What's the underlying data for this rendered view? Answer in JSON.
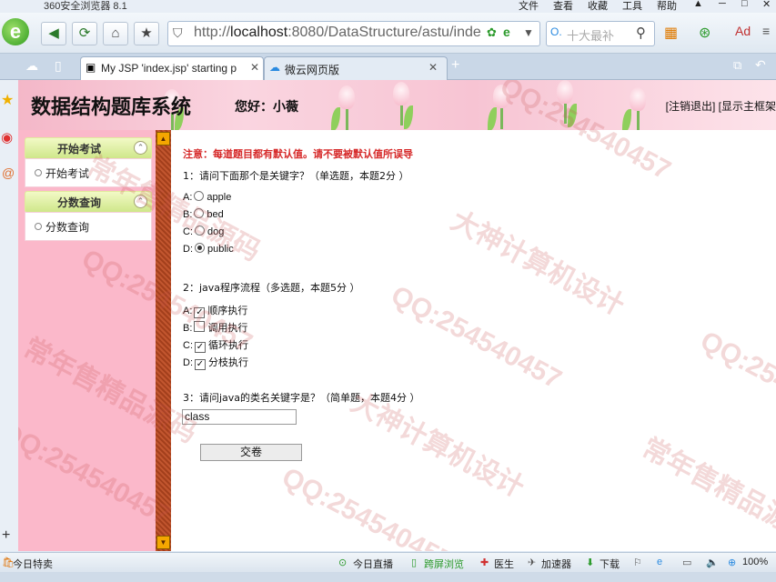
{
  "browser": {
    "title": "360安全浏览器 8.1",
    "menu": [
      "文件",
      "查看",
      "收藏",
      "工具",
      "帮助"
    ],
    "url_prefix": "http://",
    "url_host": "localhost",
    "url_rest": ":8080/DataStructure/astu/inde",
    "search_placeholder": "十大最补",
    "tabs": [
      {
        "label": "My JSP 'index.jsp' starting p"
      },
      {
        "label": "微云网页版"
      }
    ]
  },
  "header": {
    "system_title": "数据结构题库系统",
    "greeting": "您好：小薇",
    "top_links": "[注销退出] [显示主框架"
  },
  "sidebar": {
    "groups": [
      {
        "title": "开始考试",
        "items": [
          "开始考试"
        ]
      },
      {
        "title": "分数查询",
        "items": [
          "分数查询"
        ]
      }
    ]
  },
  "exam": {
    "notice": "注意：每道题目都有默认值。请不要被默认值所误导",
    "questions": [
      {
        "title": "1：请问下面那个是关键字？（单选题，本题2分 ）",
        "type": "radio",
        "options": [
          {
            "key": "A:",
            "text": "apple",
            "checked": false
          },
          {
            "key": "B:",
            "text": "bed",
            "checked": false
          },
          {
            "key": "C:",
            "text": "dog",
            "checked": false
          },
          {
            "key": "D:",
            "text": "public",
            "checked": true
          }
        ]
      },
      {
        "title": "2：java程序流程（多选题，本题5分 ）",
        "type": "checkbox",
        "options": [
          {
            "key": "A:",
            "text": "顺序执行",
            "checked": true
          },
          {
            "key": "B:",
            "text": "调用执行",
            "checked": false
          },
          {
            "key": "C:",
            "text": "循环执行",
            "checked": true
          },
          {
            "key": "D:",
            "text": "分枝执行",
            "checked": true
          }
        ]
      },
      {
        "title": "3：请问java的类名关键字是？（简单题，本题4分 ）",
        "type": "text",
        "answer": "class"
      }
    ],
    "submit_label": "交卷"
  },
  "statusbar": {
    "left": "今日特卖",
    "items": [
      "今日直播",
      "跨屏浏览",
      "医生",
      "加速器",
      "下载"
    ],
    "zoom": "100%"
  },
  "watermark": [
    "常年售精品源码",
    "大神计算机设计",
    "QQ:254540457"
  ]
}
